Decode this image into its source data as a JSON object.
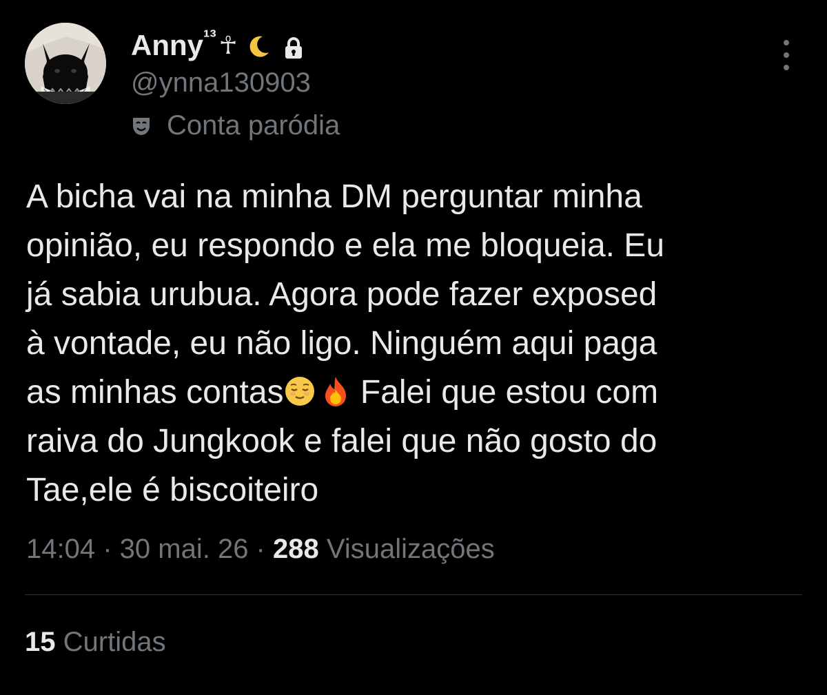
{
  "author": {
    "name": "Anny",
    "name_superscript": "¹³",
    "name_glyph": "☥",
    "handle": "@ynna130903",
    "parody_label": "Conta paródia"
  },
  "icons": {
    "avatar": "black-cat-avatar",
    "moon": "crescent-moon-icon",
    "lock": "lock-icon",
    "parody": "theater-mask-icon",
    "more": "more-options-icon",
    "emoji_1": "relieved-face-emoji",
    "emoji_2": "fire-emoji"
  },
  "tweet": {
    "line1": "A bicha vai na minha DM perguntar minha",
    "line2": "opinião, eu respondo e ela me bloqueia. Eu",
    "line3": "já sabia urubua. Agora pode fazer exposed",
    "line4": "à vontade, eu não ligo. Ninguém aqui paga",
    "line5_a": "as minhas contas",
    "line5_b": " Falei que estou com",
    "line6": "raiva do Jungkook e falei que não gosto do",
    "line7": "Tae,ele é biscoiteiro"
  },
  "meta": {
    "time": "14:04",
    "date": "30 mai. 26",
    "separator": " · ",
    "views_count": "288",
    "views_label": "Visualizações"
  },
  "engagement": {
    "likes_count": "15",
    "likes_label": "Curtidas"
  },
  "colors": {
    "background": "#000000",
    "text_primary": "#e7e9ea",
    "text_secondary": "#71767b",
    "divider": "#2f3336"
  }
}
